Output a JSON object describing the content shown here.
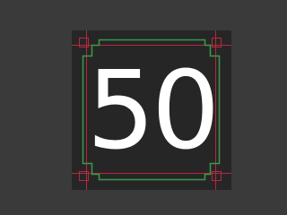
{
  "glyph": {
    "text": "50"
  },
  "colors": {
    "background": "#3a3a3a",
    "canvas": "#262626",
    "glyph": "#ffffff",
    "content_box_outline": "#3a9a4a",
    "bounds_outline": "#b8283c"
  }
}
